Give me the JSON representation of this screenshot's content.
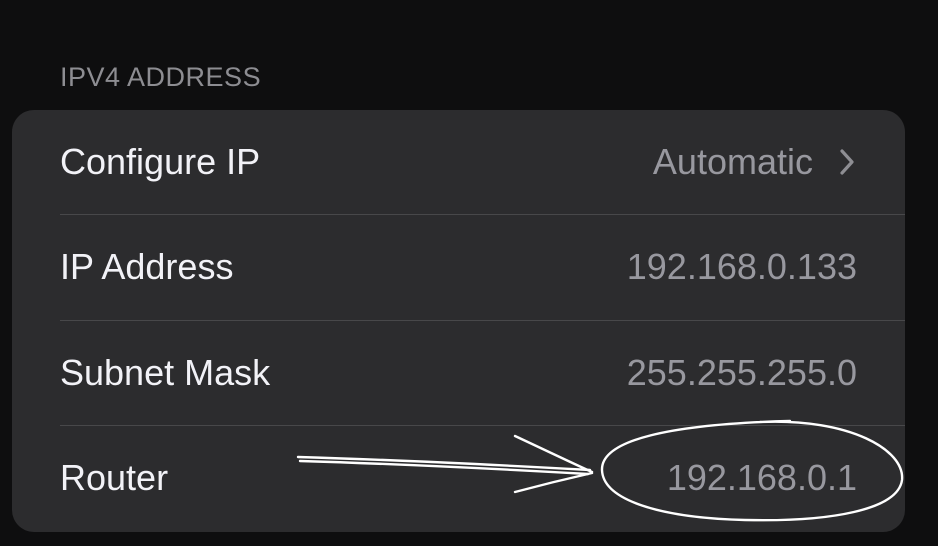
{
  "section": {
    "header": "IPV4 ADDRESS"
  },
  "rows": [
    {
      "label": "Configure IP",
      "value": "Automatic",
      "chevron": true
    },
    {
      "label": "IP Address",
      "value": "192.168.0.133",
      "chevron": false
    },
    {
      "label": "Subnet Mask",
      "value": "255.255.255.0",
      "chevron": false
    },
    {
      "label": "Router",
      "value": "192.168.0.1",
      "chevron": false
    }
  ],
  "colors": {
    "background": "#0e0e0f",
    "group_background": "#2c2c2e",
    "label_text": "#f2f2f7",
    "value_text": "#98989f",
    "header_text": "#8d8d92",
    "separator": "#48484a",
    "annotation_ink": "#ffffff"
  },
  "icons": {
    "disclosure": "chevron-right-icon",
    "annotation_arrow": "hand-drawn-arrow",
    "annotation_circle": "hand-drawn-ellipse"
  }
}
